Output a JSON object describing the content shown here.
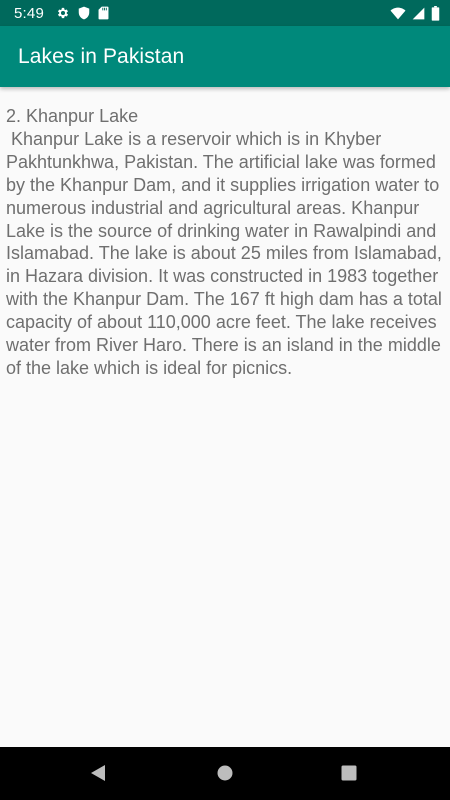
{
  "status_bar": {
    "time": "5:49",
    "left_icons": [
      "gear-icon",
      "shield-icon",
      "sd-card-icon"
    ],
    "right_icons": [
      "wifi-icon",
      "cellular-signal-icon",
      "battery-icon"
    ]
  },
  "app_bar": {
    "title": "Lakes in Pakistan",
    "color": "#00897b",
    "status_color": "#00695c"
  },
  "content": {
    "heading": "2. Khanpur Lake",
    "body": " Khanpur Lake is a reservoir which is in Khyber Pakhtunkhwa, Pakistan. The artificial lake was formed by the Khanpur Dam, and it supplies irrigation water to numerous industrial and agricultural areas. Khanpur Lake is the source of drinking water in Rawalpindi and Islamabad. The lake is about 25 miles from Islamabad, in Hazara division. It was constructed in 1983 together with the Khanpur Dam. The 167 ft high dam has a total capacity of about 110,000 acre feet. The lake receives water from River Haro. There is an island in the middle of the lake which is ideal for picnics."
  },
  "nav_bar": {
    "buttons": [
      "back-icon",
      "home-icon",
      "recents-icon"
    ]
  }
}
